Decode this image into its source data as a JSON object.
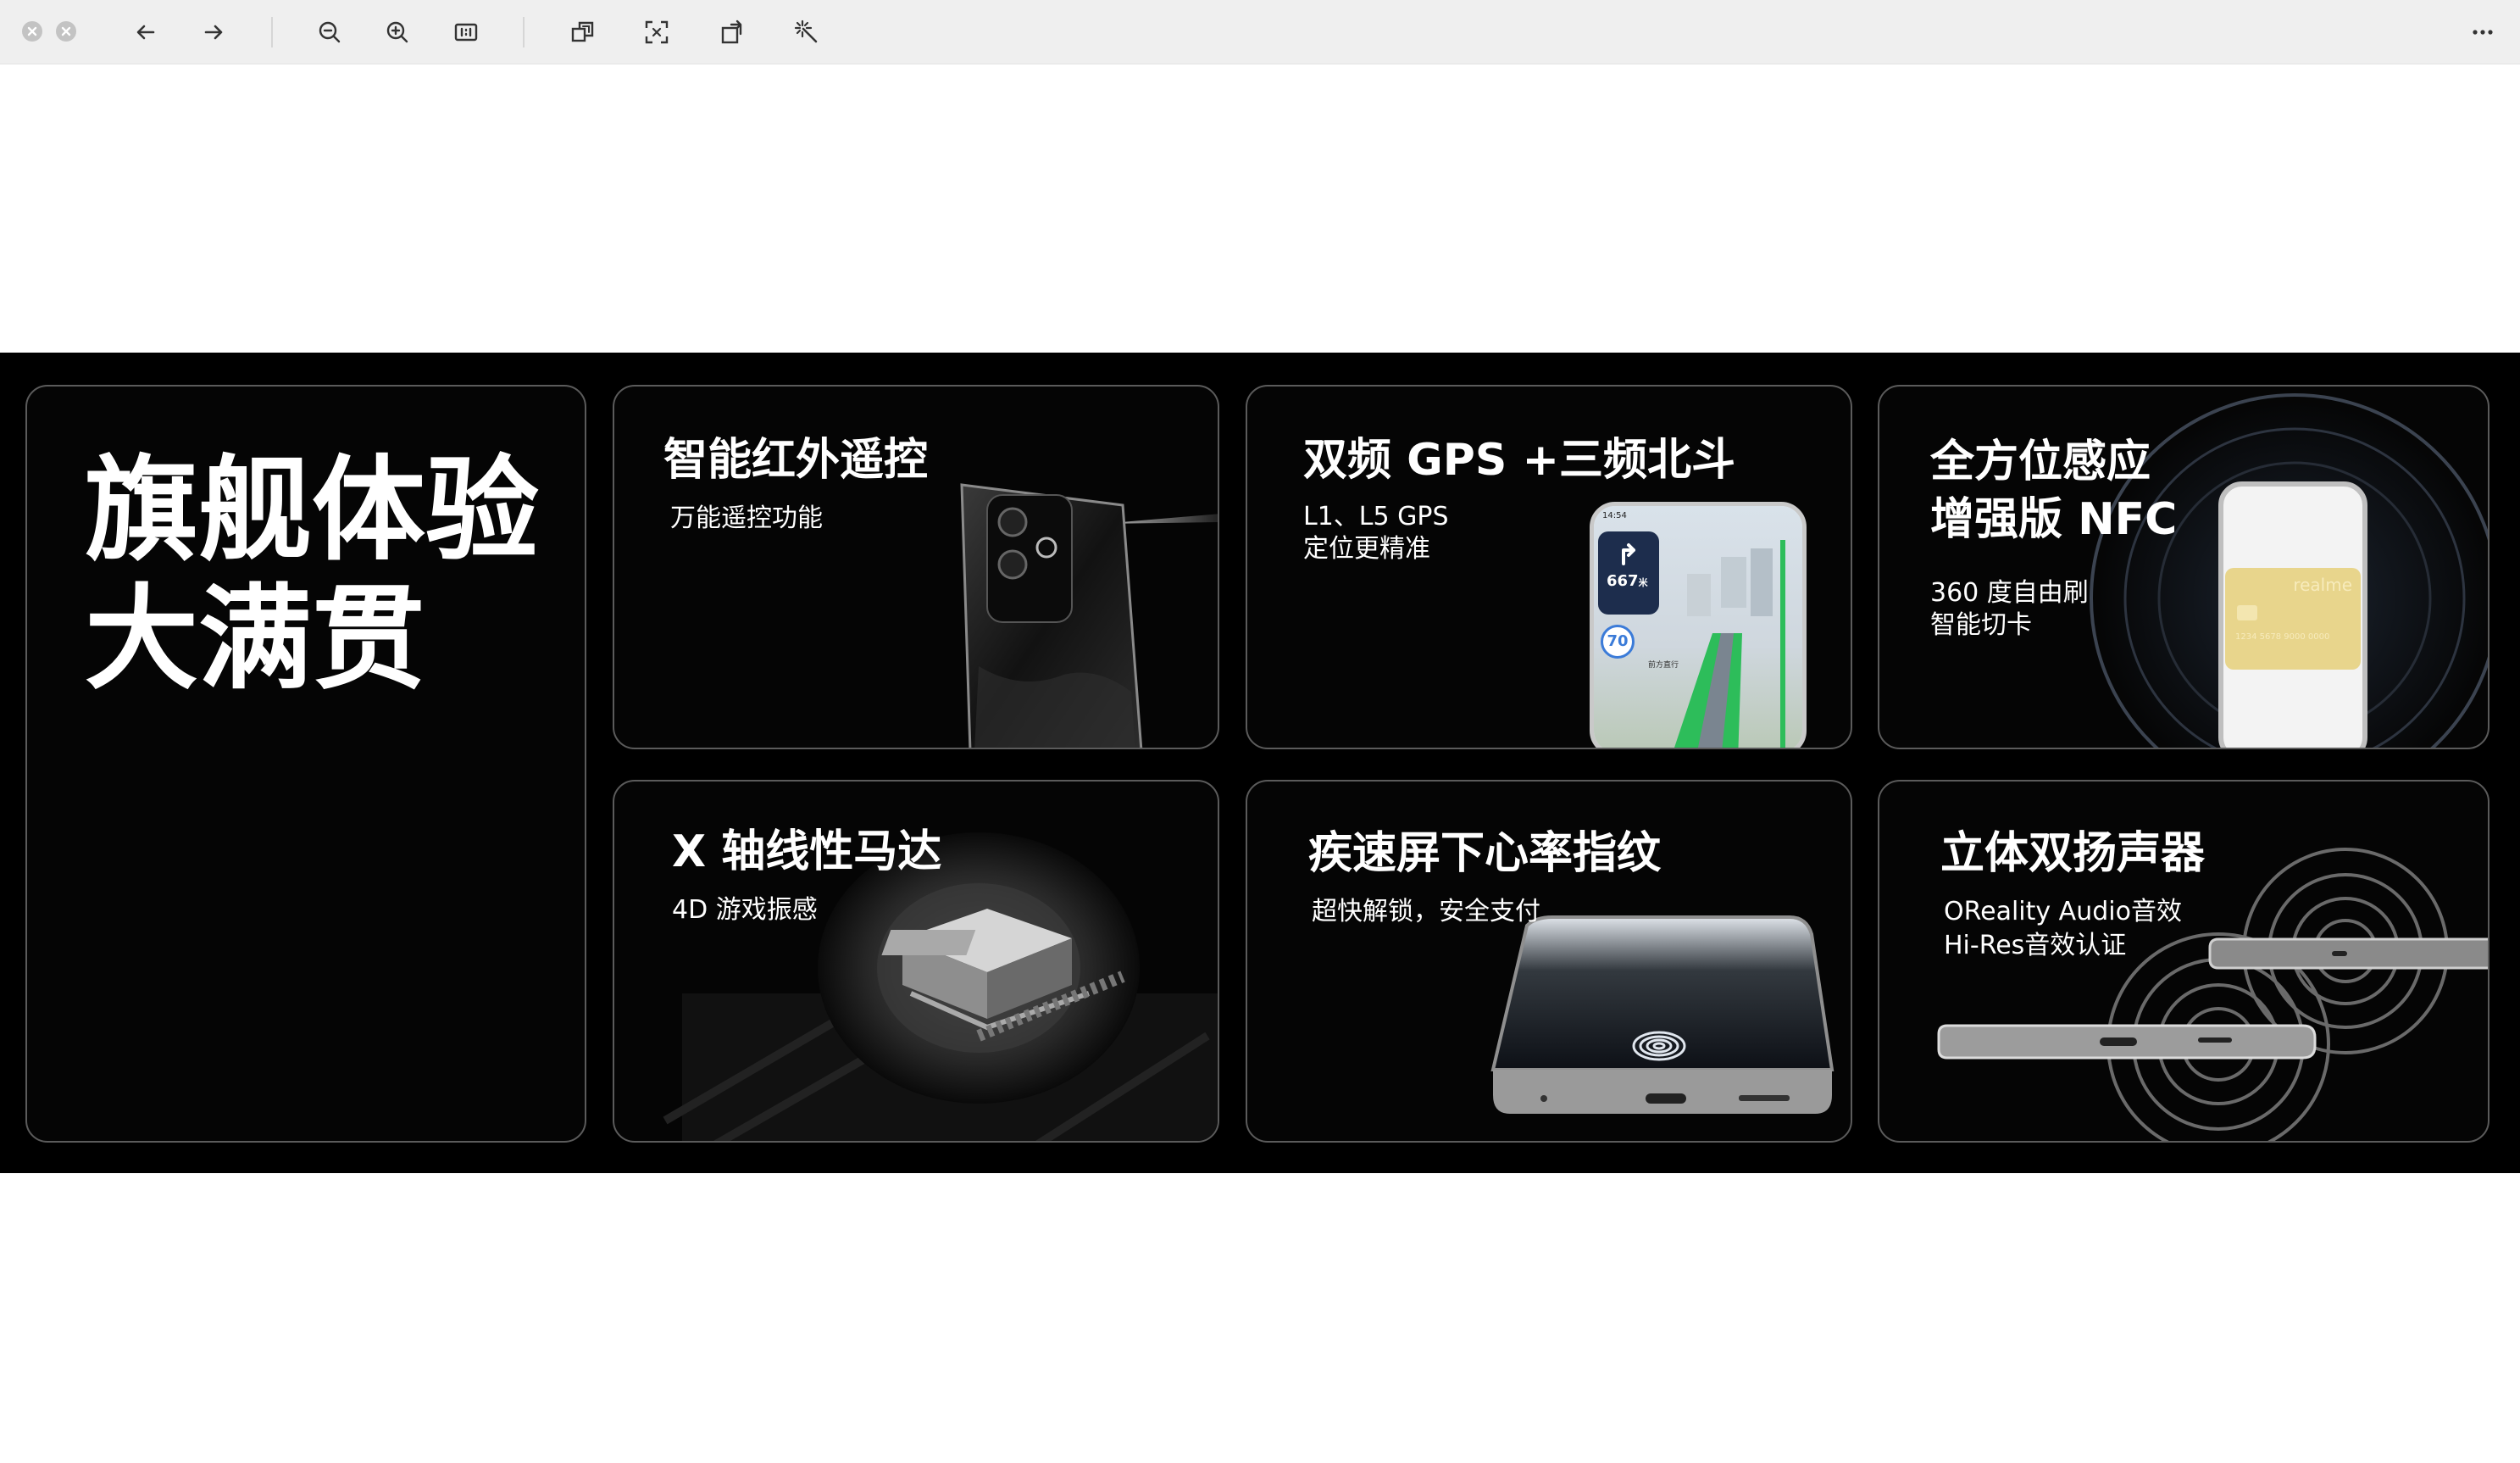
{
  "toolbar": {
    "icons": [
      "close-icon",
      "minimize-icon",
      "back-arrow-icon",
      "forward-arrow-icon",
      "zoom-out-icon",
      "zoom-in-icon",
      "actual-size-icon",
      "crop-icon",
      "fit-screen-icon",
      "rotate-icon",
      "magic-wand-icon",
      "more-icon"
    ]
  },
  "banner": {
    "headline_line1": "旗舰体验",
    "headline_line2": "大满贯",
    "cards": [
      {
        "title": "智能红外遥控",
        "sub1": "万能遥控功能"
      },
      {
        "title": "双频 GPS +三频北斗",
        "sub1": "L1、L5 GPS",
        "sub2": "定位更精准"
      },
      {
        "title_line1": "全方位感应",
        "title_line2": "增强版 NFC",
        "sub1": "360 度自由刷",
        "sub2": "智能切卡"
      },
      {
        "title": "X 轴线性马达",
        "sub1": "4D 游戏振感"
      },
      {
        "title": "疾速屏下心率指纹",
        "sub1": "超快解锁，安全支付"
      },
      {
        "title": "立体双扬声器",
        "sub1": "OReality Audio音效",
        "sub2": "Hi-Res音效认证"
      }
    ],
    "nav_screen": {
      "time": "14:54",
      "distance": "667",
      "distance_unit": "米",
      "speed": "70",
      "hint": "前方直行"
    },
    "nfc_card_brand": "realme",
    "nfc_card_number": "1234 5678 9000 0000"
  }
}
